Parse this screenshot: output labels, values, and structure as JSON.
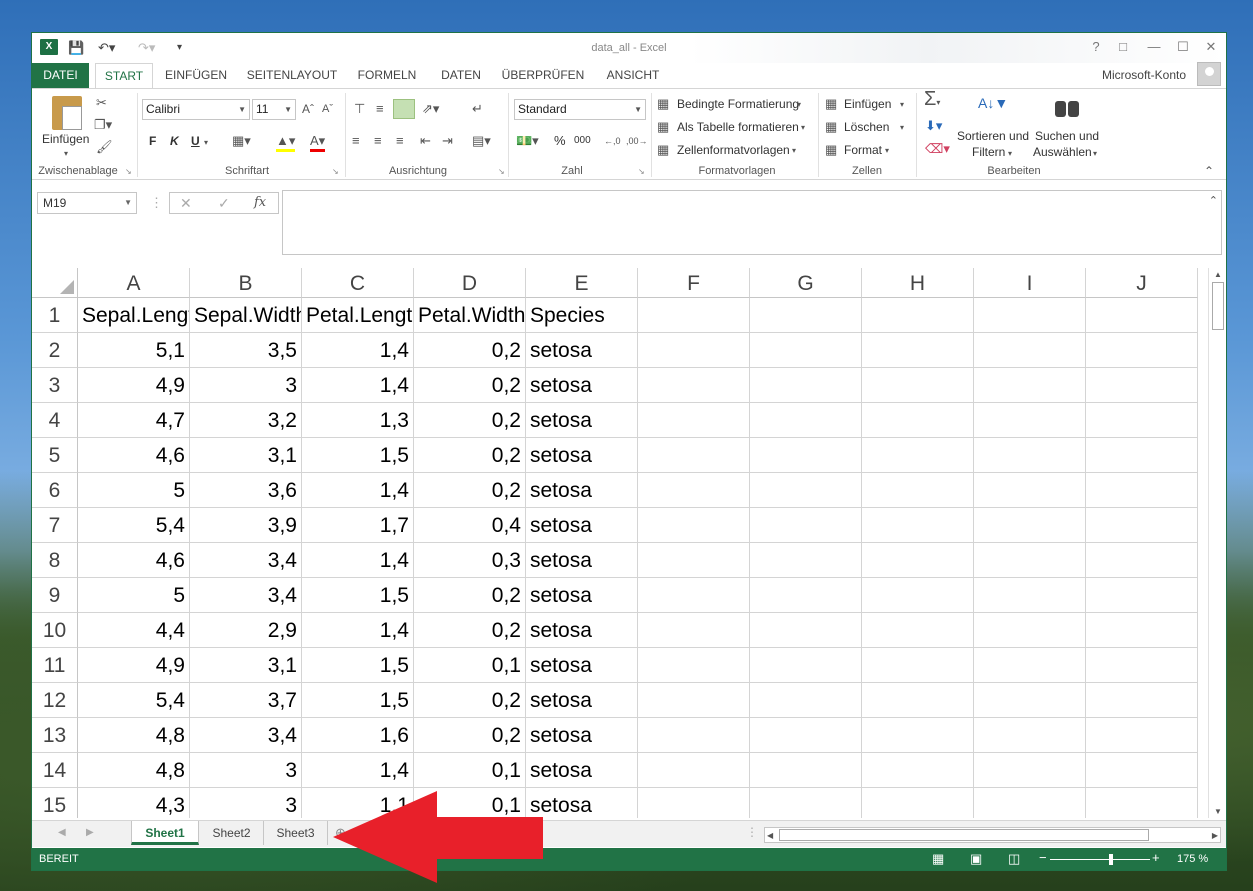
{
  "window": {
    "title": "data_all - Excel"
  },
  "tabs": [
    "DATEI",
    "START",
    "EINFÜGEN",
    "SEITENLAYOUT",
    "FORMELN",
    "DATEN",
    "ÜBERPRÜFEN",
    "ANSICHT"
  ],
  "account": "Microsoft-Konto",
  "ribbon": {
    "clipboard": {
      "paste": "Einfügen",
      "label": "Zwischenablage"
    },
    "font": {
      "name": "Calibri",
      "size": "11",
      "bold": "F",
      "italic": "K",
      "underline": "U",
      "label": "Schriftart"
    },
    "alignment": {
      "label": "Ausrichtung"
    },
    "number": {
      "format": "Standard",
      "percent": "%",
      "thousands": "000",
      "label": "Zahl"
    },
    "styles": {
      "conditional": "Bedingte Formatierung",
      "as_table": "Als Tabelle formatieren",
      "cell_styles": "Zellenformatvorlagen",
      "label": "Formatvorlagen"
    },
    "cells": {
      "insert": "Einfügen",
      "delete": "Löschen",
      "format": "Format",
      "label": "Zellen"
    },
    "editing": {
      "sort_line1": "Sortieren und",
      "sort_line2": "Filtern",
      "find_line1": "Suchen und",
      "find_line2": "Auswählen",
      "label": "Bearbeiten"
    }
  },
  "formula_bar": {
    "name_box": "M19",
    "fx": "fx",
    "value": ""
  },
  "grid": {
    "columns": [
      "A",
      "B",
      "C",
      "D",
      "E",
      "F",
      "G",
      "H",
      "I",
      "J"
    ],
    "rows": [
      [
        "Sepal.Length",
        "Sepal.Width",
        "Petal.Length",
        "Petal.Width",
        "Species"
      ],
      [
        "5,1",
        "3,5",
        "1,4",
        "0,2",
        "setosa"
      ],
      [
        "4,9",
        "3",
        "1,4",
        "0,2",
        "setosa"
      ],
      [
        "4,7",
        "3,2",
        "1,3",
        "0,2",
        "setosa"
      ],
      [
        "4,6",
        "3,1",
        "1,5",
        "0,2",
        "setosa"
      ],
      [
        "5",
        "3,6",
        "1,4",
        "0,2",
        "setosa"
      ],
      [
        "5,4",
        "3,9",
        "1,7",
        "0,4",
        "setosa"
      ],
      [
        "4,6",
        "3,4",
        "1,4",
        "0,3",
        "setosa"
      ],
      [
        "5",
        "3,4",
        "1,5",
        "0,2",
        "setosa"
      ],
      [
        "4,4",
        "2,9",
        "1,4",
        "0,2",
        "setosa"
      ],
      [
        "4,9",
        "3,1",
        "1,5",
        "0,1",
        "setosa"
      ],
      [
        "5,4",
        "3,7",
        "1,5",
        "0,2",
        "setosa"
      ],
      [
        "4,8",
        "3,4",
        "1,6",
        "0,2",
        "setosa"
      ],
      [
        "4,8",
        "3",
        "1,4",
        "0,1",
        "setosa"
      ],
      [
        "4,3",
        "3",
        "1,1",
        "0,1",
        "setosa"
      ]
    ]
  },
  "sheets": [
    "Sheet1",
    "Sheet2",
    "Sheet3"
  ],
  "active_sheet": "Sheet1",
  "status": {
    "mode": "BEREIT",
    "zoom": "175 %"
  },
  "colors": {
    "accent": "#217346",
    "arrow": "#e8202a"
  }
}
